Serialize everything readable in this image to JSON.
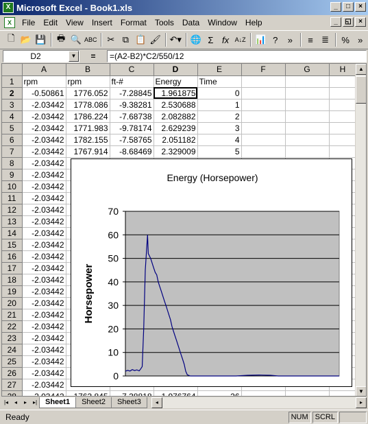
{
  "window": {
    "title": "Microsoft Excel - Book1.xls",
    "app_icon": "X",
    "minimize": "_",
    "maximize": "□",
    "close": "×"
  },
  "menu": {
    "items": [
      "File",
      "Edit",
      "View",
      "Insert",
      "Format",
      "Tools",
      "Data",
      "Window",
      "Help"
    ],
    "doc_min": "_",
    "doc_restore": "◱",
    "doc_close": "×"
  },
  "toolbar": {
    "buttons": [
      "new-icon",
      "open-icon",
      "save-icon",
      "print-icon",
      "print-preview-icon",
      "spelling-icon",
      "cut-icon",
      "copy-icon",
      "paste-icon",
      "format-painter-icon",
      "undo-icon",
      "hyperlink-icon",
      "autosum-icon",
      "paste-function-icon",
      "sort-ascending-icon",
      "chart-wizard-icon",
      "help-icon",
      "more-icon",
      "align-left-icon",
      "align-right-icon",
      "percent-icon",
      "more-icon-2"
    ]
  },
  "formula_bar": {
    "name_box": "D2",
    "equals": "=",
    "formula": "=(A2-B2)*C2/550/12"
  },
  "sheet": {
    "columns": [
      "A",
      "B",
      "C",
      "D",
      "E",
      "F",
      "G",
      "H"
    ],
    "active_col": "D",
    "active_row": "2",
    "rows": [
      {
        "n": "1",
        "cells": [
          "rpm",
          "rpm",
          "ft-#",
          "Energy",
          "Time",
          "",
          "",
          ""
        ]
      },
      {
        "n": "2",
        "cells": [
          "-0.50861",
          "1776.052",
          "-7.28845",
          "1.961875",
          "0",
          "",
          "",
          ""
        ]
      },
      {
        "n": "3",
        "cells": [
          "-2.03442",
          "1778.086",
          "-9.38281",
          "2.530688",
          "1",
          "",
          "",
          ""
        ]
      },
      {
        "n": "4",
        "cells": [
          "-2.03442",
          "1786.224",
          "-7.68738",
          "2.082882",
          "2",
          "",
          "",
          ""
        ]
      },
      {
        "n": "5",
        "cells": [
          "-2.03442",
          "1771.983",
          "-9.78174",
          "2.629239",
          "3",
          "",
          "",
          ""
        ]
      },
      {
        "n": "6",
        "cells": [
          "-2.03442",
          "1782.155",
          "-7.58765",
          "2.051182",
          "4",
          "",
          "",
          ""
        ]
      },
      {
        "n": "7",
        "cells": [
          "-2.03442",
          "1767.914",
          "-8.68469",
          "2.329009",
          "5",
          "",
          "",
          ""
        ]
      },
      {
        "n": "8",
        "cells": [
          "-2.03442",
          "",
          "",
          "",
          "",
          "",
          "",
          ""
        ]
      },
      {
        "n": "9",
        "cells": [
          "-2.03442",
          "",
          "",
          "",
          "",
          "",
          "",
          ""
        ]
      },
      {
        "n": "10",
        "cells": [
          "-2.03442",
          "",
          "",
          "",
          "",
          "",
          "",
          ""
        ]
      },
      {
        "n": "11",
        "cells": [
          "-2.03442",
          "",
          "",
          "",
          "",
          "",
          "",
          ""
        ]
      },
      {
        "n": "12",
        "cells": [
          "-2.03442",
          "",
          "",
          "",
          "",
          "",
          "",
          ""
        ]
      },
      {
        "n": "13",
        "cells": [
          "-2.03442",
          "",
          "",
          "",
          "",
          "",
          "",
          ""
        ]
      },
      {
        "n": "14",
        "cells": [
          "-2.03442",
          "",
          "",
          "",
          "",
          "",
          "",
          ""
        ]
      },
      {
        "n": "15",
        "cells": [
          "-2.03442",
          "",
          "",
          "",
          "",
          "",
          "",
          ""
        ]
      },
      {
        "n": "16",
        "cells": [
          "-2.03442",
          "",
          "",
          "",
          "",
          "",
          "",
          ""
        ]
      },
      {
        "n": "17",
        "cells": [
          "-2.03442",
          "",
          "",
          "",
          "",
          "",
          "",
          ""
        ]
      },
      {
        "n": "18",
        "cells": [
          "-2.03442",
          "",
          "",
          "",
          "",
          "",
          "",
          ""
        ]
      },
      {
        "n": "19",
        "cells": [
          "-2.03442",
          "",
          "",
          "",
          "",
          "",
          "",
          ""
        ]
      },
      {
        "n": "20",
        "cells": [
          "-2.03442",
          "",
          "",
          "",
          "",
          "",
          "",
          ""
        ]
      },
      {
        "n": "21",
        "cells": [
          "-2.03442",
          "",
          "",
          "",
          "",
          "",
          "",
          ""
        ]
      },
      {
        "n": "22",
        "cells": [
          "-2.03442",
          "",
          "",
          "",
          "",
          "",
          "",
          ""
        ]
      },
      {
        "n": "23",
        "cells": [
          "-2.03442",
          "",
          "",
          "",
          "",
          "",
          "",
          ""
        ]
      },
      {
        "n": "24",
        "cells": [
          "-2.03442",
          "",
          "",
          "",
          "",
          "",
          "",
          ""
        ]
      },
      {
        "n": "25",
        "cells": [
          "-2.03442",
          "",
          "",
          "",
          "",
          "",
          "",
          ""
        ]
      },
      {
        "n": "26",
        "cells": [
          "-2.03442",
          "",
          "",
          "",
          "",
          "",
          "",
          ""
        ]
      },
      {
        "n": "27",
        "cells": [
          "-2.03442",
          "",
          "",
          "",
          "",
          "",
          "",
          ""
        ]
      },
      {
        "n": "28",
        "cells": [
          "-2.03442",
          "1763.845",
          "-7.38818",
          "1.976764",
          "26",
          "",
          "",
          ""
        ]
      }
    ]
  },
  "chart_data": {
    "type": "line",
    "title": "Energy (Horsepower)",
    "xlabel": "",
    "ylabel": "Horsepower",
    "ylim": [
      0,
      70
    ],
    "yticks": [
      "0",
      "10",
      "20",
      "30",
      "40",
      "50",
      "60",
      "70"
    ],
    "xlim": [
      0,
      560
    ],
    "grid": true,
    "series": [
      {
        "values": [
          [
            0,
            2
          ],
          [
            6,
            2.4
          ],
          [
            12,
            2.1
          ],
          [
            18,
            2.7
          ],
          [
            24,
            2.3
          ],
          [
            30,
            2.6
          ],
          [
            36,
            2.2
          ],
          [
            40,
            3
          ],
          [
            44,
            4
          ],
          [
            48,
            20
          ],
          [
            52,
            45
          ],
          [
            56,
            55
          ],
          [
            58,
            60
          ],
          [
            60,
            52
          ],
          [
            63,
            51
          ],
          [
            66,
            50
          ],
          [
            70,
            48
          ],
          [
            74,
            46
          ],
          [
            78,
            44
          ],
          [
            82,
            43
          ],
          [
            86,
            40
          ],
          [
            90,
            38
          ],
          [
            94,
            36
          ],
          [
            98,
            34
          ],
          [
            102,
            32
          ],
          [
            106,
            30
          ],
          [
            110,
            28
          ],
          [
            114,
            26
          ],
          [
            118,
            24
          ],
          [
            122,
            21
          ],
          [
            126,
            19
          ],
          [
            130,
            17
          ],
          [
            134,
            15
          ],
          [
            138,
            13
          ],
          [
            142,
            11
          ],
          [
            146,
            9
          ],
          [
            150,
            7
          ],
          [
            154,
            5
          ],
          [
            158,
            2
          ],
          [
            162,
            0.5
          ],
          [
            170,
            0
          ],
          [
            200,
            0
          ],
          [
            230,
            0
          ],
          [
            260,
            0
          ],
          [
            290,
            0
          ],
          [
            320,
            0.3
          ],
          [
            350,
            0.4
          ],
          [
            380,
            0.3
          ],
          [
            400,
            0
          ],
          [
            430,
            0
          ],
          [
            480,
            0
          ],
          [
            560,
            0
          ]
        ]
      }
    ]
  },
  "colors": {
    "line": "#000080",
    "plot_bg": "#c0c0c0",
    "title_bar": "#0a246a"
  },
  "tabs": {
    "nav": [
      "|◂",
      "◂",
      "▸",
      "▸|"
    ],
    "sheets": [
      "Sheet1",
      "Sheet2",
      "Sheet3"
    ],
    "active": "Sheet1"
  },
  "status": {
    "text": "Ready",
    "num": "NUM",
    "scrl": "SCRL"
  }
}
